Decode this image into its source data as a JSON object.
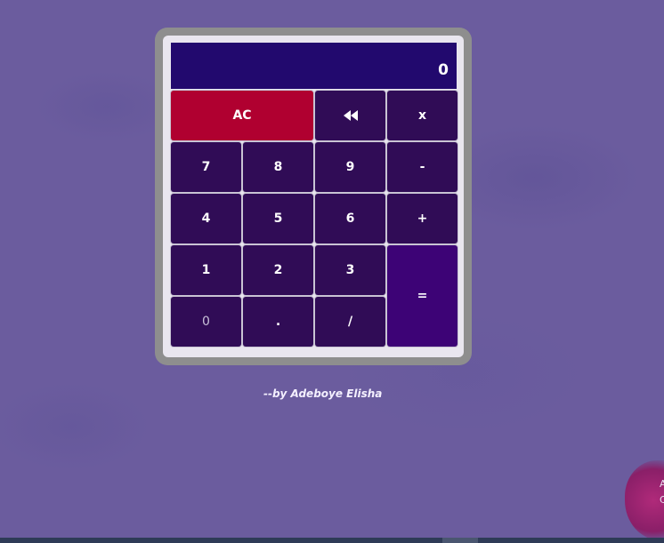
{
  "calculator": {
    "display_value": "0",
    "keys": {
      "ac": "AC",
      "backspace_icon": "rewind-icon",
      "multiply": "x",
      "seven": "7",
      "eight": "8",
      "nine": "9",
      "minus": "-",
      "four": "4",
      "five": "5",
      "six": "6",
      "plus": "+",
      "one": "1",
      "two": "2",
      "three": "3",
      "equals": "=",
      "zero": "0",
      "dot": ".",
      "divide": "/"
    }
  },
  "credit": "--by Adeboye Elisha",
  "corner_text": "A\nC",
  "colors": {
    "background": "#6b5c9e",
    "display": "#22096e",
    "key": "#300c56",
    "ac_key": "#b00030",
    "equals_key": "#3d0376"
  }
}
